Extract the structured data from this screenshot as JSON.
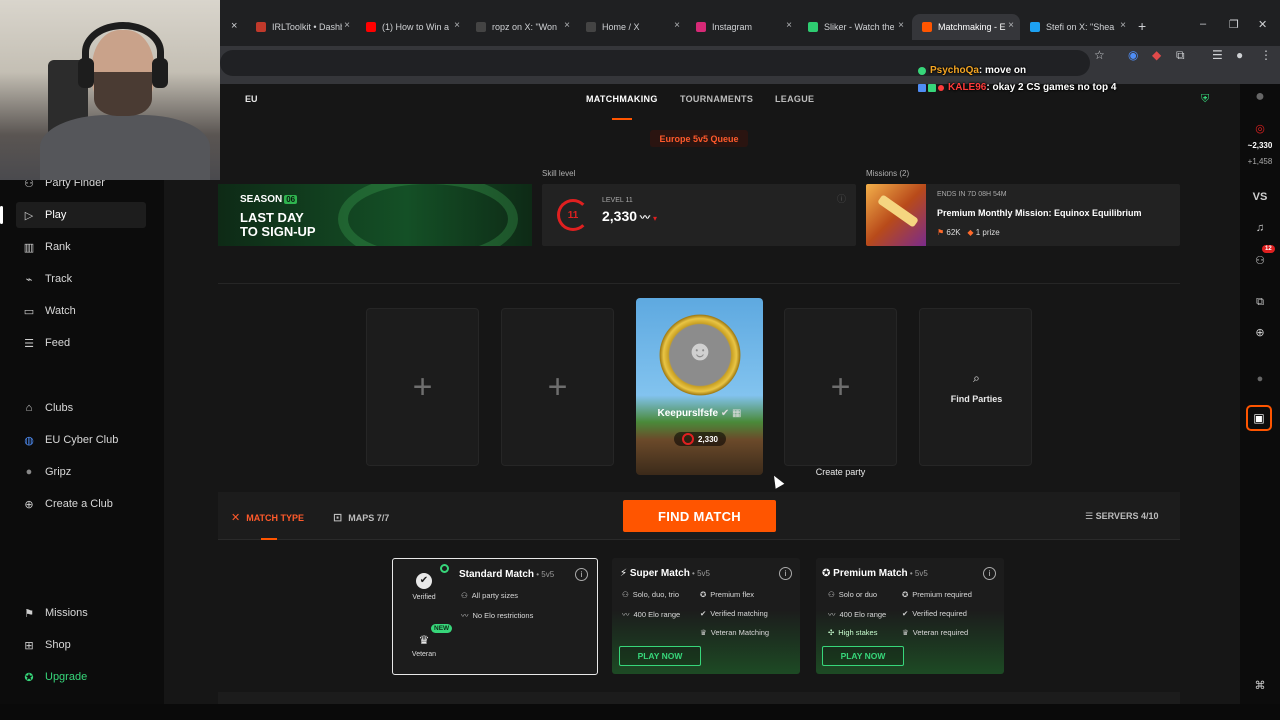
{
  "browser": {
    "tabs": [
      {
        "title": "IRLToolkit • Dashb",
        "color": "#c0392b"
      },
      {
        "title": "(1) How to Win a",
        "color": "#ff0000"
      },
      {
        "title": "ropz on X: \"Won",
        "color": "#ffffff"
      },
      {
        "title": "Home / X",
        "color": "#ffffff"
      },
      {
        "title": "Instagram",
        "color": "#d62976"
      },
      {
        "title": "Sliker - Watch the",
        "color": "#2ecc71"
      },
      {
        "title": "Matchmaking - E",
        "color": "#ff5500"
      },
      {
        "title": "Stefi on X: \"Shea",
        "color": "#1da1f2"
      }
    ],
    "tab_close": "×",
    "new_tab": "+",
    "window_controls": [
      "–",
      "❐",
      "✕"
    ]
  },
  "chat": [
    {
      "user": "PsychoQa",
      "message": ": move on",
      "dot_color": "#37d67a"
    },
    {
      "user": "KALE96",
      "message": ": okay 2 CS games no top 4",
      "dot_color": "#ff3b3b"
    }
  ],
  "sidebar": {
    "items": [
      {
        "label": "Party Finder",
        "icon": "party-icon"
      },
      {
        "label": "Play",
        "icon": "play-icon"
      },
      {
        "label": "Rank",
        "icon": "rank-icon"
      },
      {
        "label": "Track",
        "icon": "track-icon"
      },
      {
        "label": "Watch",
        "icon": "watch-icon"
      },
      {
        "label": "Feed",
        "icon": "feed-icon"
      },
      {
        "label": "Clubs",
        "icon": "clubs-icon"
      },
      {
        "label": "EU Cyber Club",
        "icon": "globe-icon"
      },
      {
        "label": "Gripz",
        "icon": "club-icon"
      },
      {
        "label": "Create a Club",
        "icon": "plus-circle-icon"
      },
      {
        "label": "Missions",
        "icon": "missions-icon"
      },
      {
        "label": "Shop",
        "icon": "shop-icon"
      },
      {
        "label": "Upgrade",
        "icon": "star-icon"
      }
    ]
  },
  "header": {
    "region": "EU",
    "nav": [
      "MATCHMAKING",
      "TOURNAMENTS",
      "LEAGUE"
    ],
    "queue": "Europe 5v5 Queue"
  },
  "skill": {
    "label": "Skill level",
    "level_text": "LEVEL 11",
    "level": "11",
    "elo": "2,330"
  },
  "banner": {
    "season": "SEASON",
    "season_num": "06",
    "title_line1": "LAST DAY",
    "title_line2": "TO SIGN-UP"
  },
  "missions": {
    "label": "Missions (2)",
    "ends": "ENDS IN 7D 08H 54M",
    "title": "Premium Monthly Mission: Equinox Equilibrium",
    "points": "62K",
    "prizes": "1 prize"
  },
  "party": {
    "player_name": "Keepurslfsfe",
    "player_elo": "2,330",
    "plus": "+",
    "find_parties": "Find Parties",
    "create_party": "Create party"
  },
  "matchbar": {
    "match_type": "MATCH TYPE",
    "maps": "MAPS 7/7",
    "find_match": "FIND MATCH",
    "servers": "SERVERS 4/10"
  },
  "modes": {
    "standard": {
      "title": "Standard Match",
      "sub": " • 5v5",
      "verified": "Verified",
      "new": "NEW",
      "veteran": "Veteran",
      "features": [
        "All party sizes",
        "No Elo restrictions"
      ]
    },
    "super": {
      "title": "Super Match",
      "sub": " • 5v5",
      "features_left": [
        "Solo, duo, trio",
        "400 Elo range"
      ],
      "features_right": [
        "Premium flex",
        "Verified matching",
        "Veteran Matching"
      ],
      "play": "PLAY NOW"
    },
    "premium": {
      "title": "Premium Match",
      "sub": " • 5v5",
      "features_left": [
        "Solo or duo",
        "400 Elo range",
        "High stakes"
      ],
      "features_right": [
        "Premium required",
        "Verified required",
        "Veteran required"
      ],
      "play": "PLAY NOW"
    }
  },
  "rightbar": {
    "elo": "~2,330",
    "delta": "+1,458",
    "vs": "VS",
    "badge": "12"
  },
  "colors": {
    "accent": "#ff5500",
    "green": "#37d67a",
    "level_red": "#e02020"
  }
}
